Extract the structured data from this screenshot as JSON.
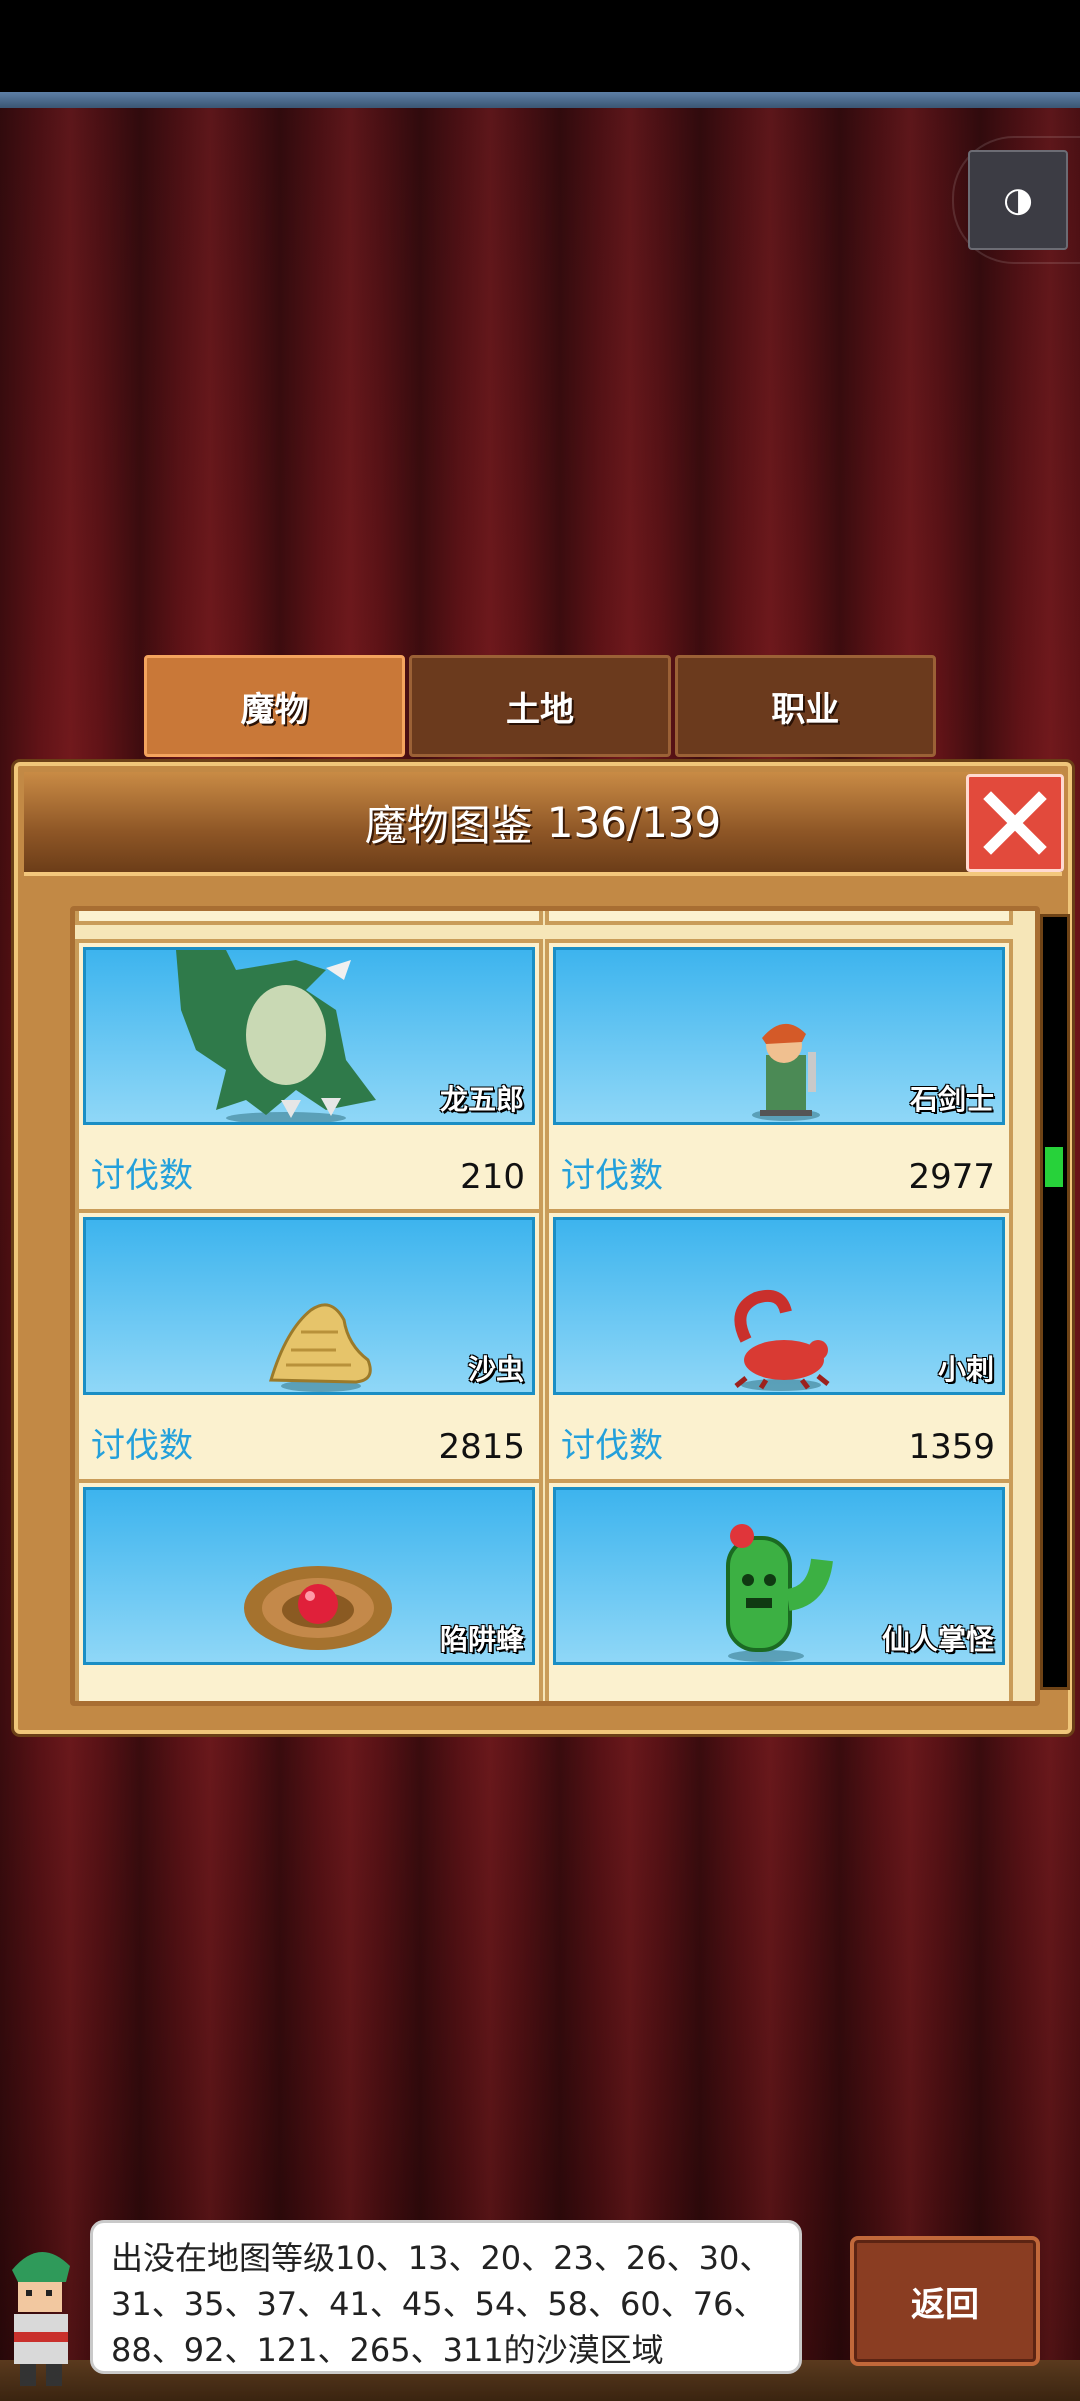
{
  "tabs": [
    {
      "label": "魔物",
      "active": true
    },
    {
      "label": "土地",
      "active": false
    },
    {
      "label": "职业",
      "active": false
    }
  ],
  "panel": {
    "title": "魔物图鉴",
    "count": "136/139",
    "close_icon": "close-x-icon"
  },
  "cards": [
    {
      "name": "龙五郎",
      "label": "讨伐数",
      "value": "210",
      "icon": "dragon-monster-icon"
    },
    {
      "name": "石剑士",
      "label": "讨伐数",
      "value": "2977",
      "icon": "stone-swordsman-monster-icon"
    },
    {
      "name": "沙虫",
      "label": "讨伐数",
      "value": "2815",
      "icon": "sandworm-monster-icon"
    },
    {
      "name": "小刺",
      "label": "讨伐数",
      "value": "1359",
      "icon": "scorpion-monster-icon"
    },
    {
      "name": "陷阱蜂",
      "label": "",
      "value": "",
      "icon": "trap-bee-monster-icon"
    },
    {
      "name": "仙人掌怪",
      "label": "",
      "value": "",
      "icon": "cactus-monster-icon"
    }
  ],
  "speech": {
    "text": "出没在地图等级10、13、20、23、26、30、31、35、37、41、45、54、58、60、76、88、92、121、265、311的沙漠区域"
  },
  "back_button": {
    "label": "返回"
  },
  "colors": {
    "accent_tab": "#c97838",
    "count_label": "#24a0db",
    "close_red": "#e24a3c"
  }
}
